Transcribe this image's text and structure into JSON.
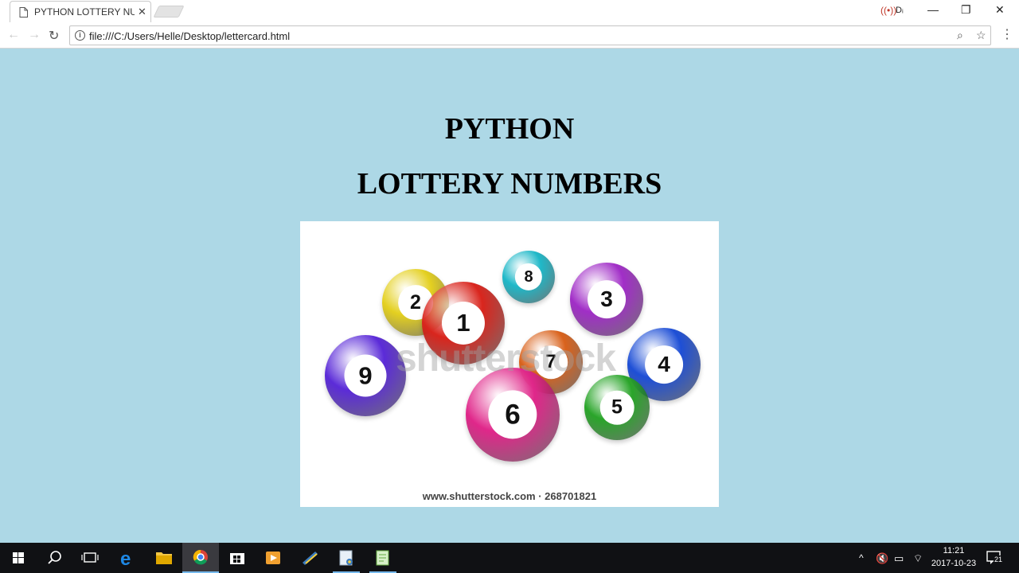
{
  "browser": {
    "tab_title": "PYTHON LOTTERY NUMBERS",
    "tab_close": "✕",
    "url": "file:///C:/Users/Helle/Desktop/lettercard.html",
    "nav": {
      "back": "←",
      "forward": "→",
      "reload": "↻"
    },
    "window_controls": {
      "minimize": "—",
      "restore": "❐",
      "close": "✕"
    },
    "menu": "⋮"
  },
  "page": {
    "heading_line1": "PYTHON",
    "heading_line2": "LOTTERY NUMBERS",
    "image": {
      "watermark": "shutterstock",
      "caption": "www.shutterstock.com · 268701821",
      "balls": [
        {
          "number": "9",
          "color": "#5b2bd8"
        },
        {
          "number": "2",
          "color": "#e4d020"
        },
        {
          "number": "1",
          "color": "#d9251d"
        },
        {
          "number": "8",
          "color": "#1fb8c8"
        },
        {
          "number": "3",
          "color": "#a12ec7"
        },
        {
          "number": "7",
          "color": "#d9621c"
        },
        {
          "number": "4",
          "color": "#1e4fd6"
        },
        {
          "number": "6",
          "color": "#e0278a"
        },
        {
          "number": "5",
          "color": "#2aa52a"
        }
      ]
    }
  },
  "taskbar": {
    "time": "11:21",
    "date": "2017-10-23",
    "notification_count": "21",
    "apps": [
      "start",
      "search",
      "task-view",
      "edge",
      "file-explorer",
      "chrome",
      "store",
      "media-player",
      "python-idle",
      "notepad",
      "notepad-plus"
    ]
  }
}
